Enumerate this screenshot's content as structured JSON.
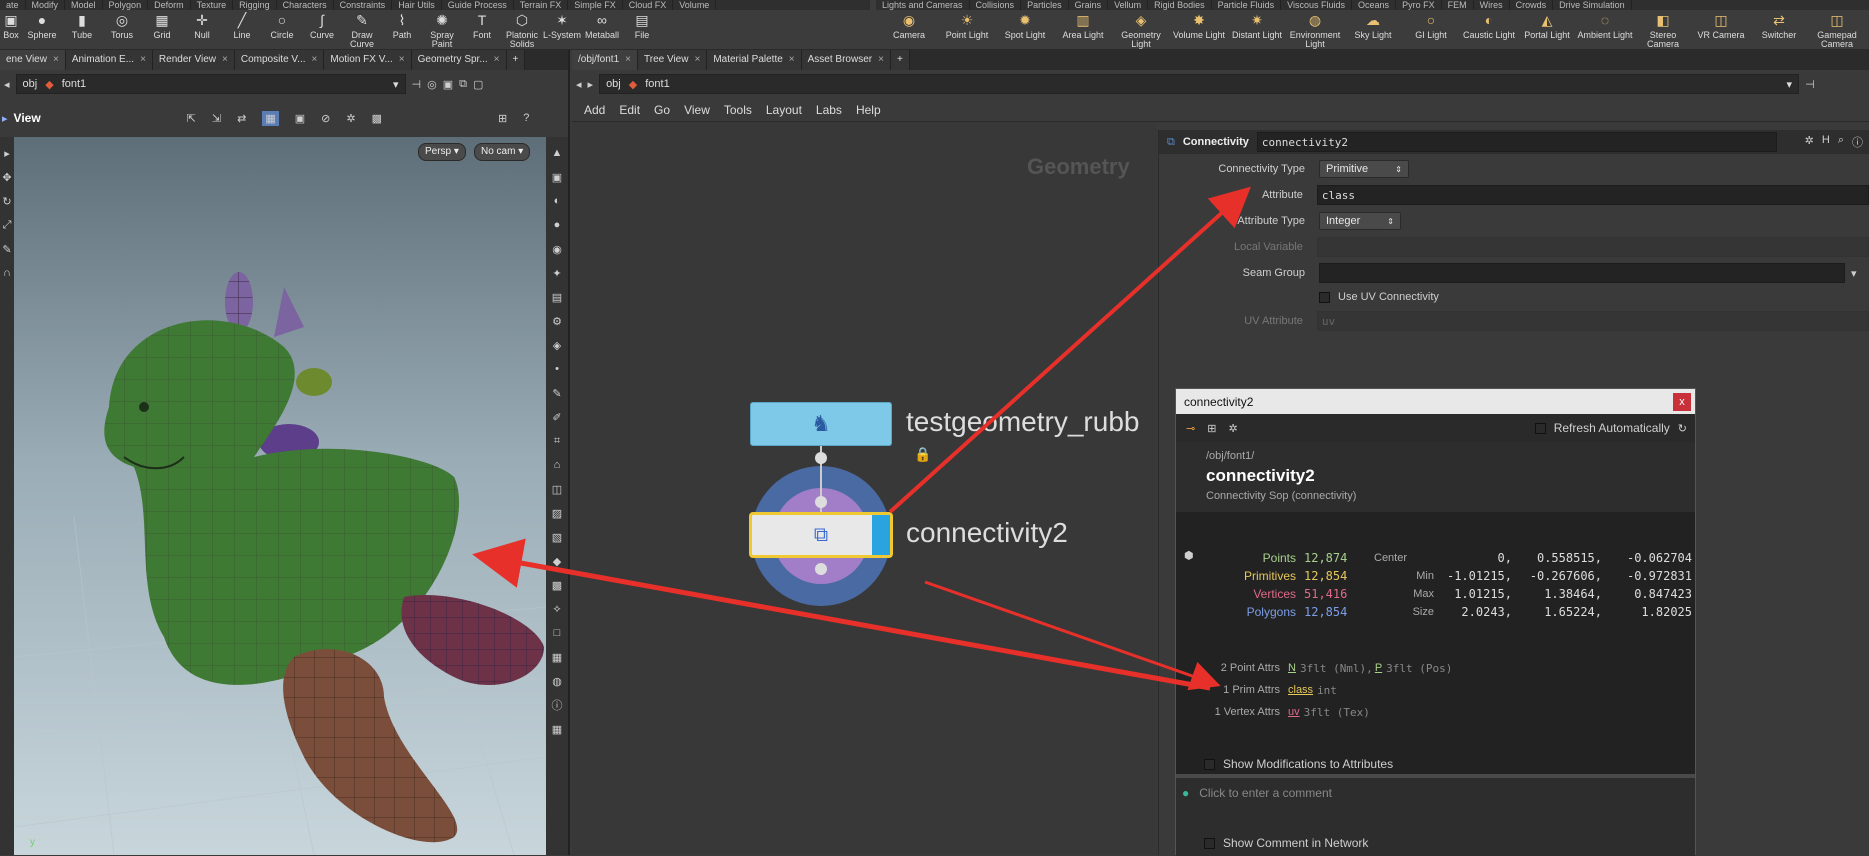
{
  "shelf": {
    "left_tabs": [
      "ate",
      "Modify",
      "Model",
      "Polygon",
      "Deform",
      "Texture",
      "Rigging",
      "Characters",
      "Constraints",
      "Hair Utils",
      "Guide Process",
      "Terrain FX",
      "Simple FX",
      "Cloud FX",
      "Volume"
    ],
    "right_tabs": [
      "Lights and Cameras",
      "Collisions",
      "Particles",
      "Grains",
      "Vellum",
      "Rigid Bodies",
      "Particle Fluids",
      "Viscous Fluids",
      "Oceans",
      "Pyro FX",
      "FEM",
      "Wires",
      "Crowds",
      "Drive Simulation"
    ],
    "left_tools": [
      {
        "label": "Box",
        "icon": "box-icon"
      },
      {
        "label": "Sphere",
        "icon": "sphere-icon"
      },
      {
        "label": "Tube",
        "icon": "tube-icon"
      },
      {
        "label": "Torus",
        "icon": "torus-icon"
      },
      {
        "label": "Grid",
        "icon": "grid-icon"
      },
      {
        "label": "Null",
        "icon": "null-icon"
      },
      {
        "label": "Line",
        "icon": "line-icon"
      },
      {
        "label": "Circle",
        "icon": "circle-icon"
      },
      {
        "label": "Curve",
        "icon": "curve-icon"
      },
      {
        "label": "Draw Curve",
        "icon": "draw-curve-icon"
      },
      {
        "label": "Path",
        "icon": "path-icon"
      },
      {
        "label": "Spray Paint",
        "icon": "spray-paint-icon"
      },
      {
        "label": "Font",
        "icon": "font-icon"
      },
      {
        "label": "Platonic Solids",
        "icon": "platonic-icon"
      },
      {
        "label": "L-System",
        "icon": "lsystem-icon"
      },
      {
        "label": "Metaball",
        "icon": "metaball-icon"
      },
      {
        "label": "File",
        "icon": "file-icon"
      }
    ],
    "right_tools": [
      {
        "label": "Camera"
      },
      {
        "label": "Point Light"
      },
      {
        "label": "Spot Light"
      },
      {
        "label": "Area Light"
      },
      {
        "label": "Geometry Light"
      },
      {
        "label": "Volume Light"
      },
      {
        "label": "Distant Light"
      },
      {
        "label": "Environment Light"
      },
      {
        "label": "Sky Light"
      },
      {
        "label": "GI Light"
      },
      {
        "label": "Caustic Light"
      },
      {
        "label": "Portal Light"
      },
      {
        "label": "Ambient Light"
      },
      {
        "label": "Stereo Camera"
      },
      {
        "label": "VR Camera"
      },
      {
        "label": "Switcher"
      },
      {
        "label": "Gamepad Camera"
      }
    ]
  },
  "left_pane": {
    "tabs": [
      "ene View",
      "Animation E...",
      "Render View",
      "Composite V...",
      "Motion FX V...",
      "Geometry Spr..."
    ],
    "path_root": "obj",
    "path_node": "font1",
    "view_label": "View",
    "persp": "Persp",
    "cam": "No cam",
    "axis_label": "y"
  },
  "network": {
    "tabs": [
      "/obj/font1",
      "Tree View",
      "Material Palette",
      "Asset Browser"
    ],
    "path_root": "obj",
    "path_node": "font1",
    "menu": [
      "Add",
      "Edit",
      "Go",
      "View",
      "Tools",
      "Layout",
      "Labs",
      "Help"
    ],
    "context_label": "Geometry",
    "node1_label": "testgeometry_rubb",
    "node2_label": "connectivity2"
  },
  "params": {
    "node_type": "Connectivity",
    "node_name": "connectivity2",
    "rows": {
      "connectivity_type_label": "Connectivity Type",
      "connectivity_type_value": "Primitive",
      "attribute_label": "Attribute",
      "attribute_value": "class",
      "attribute_type_label": "Attribute Type",
      "attribute_type_value": "Integer",
      "local_variable_label": "Local Variable",
      "seam_group_label": "Seam Group",
      "use_uv_label": "Use UV Connectivity",
      "uv_attribute_label": "UV Attribute",
      "uv_attribute_placeholder": "uv"
    }
  },
  "info": {
    "title": "connectivity2",
    "refresh_label": "Refresh Automatically",
    "path": "/obj/font1/",
    "node": "connectivity2",
    "node_type": "Connectivity Sop (connectivity)",
    "stats": [
      {
        "label": "Points",
        "value": "12,874",
        "color": "#a8d08d"
      },
      {
        "label": "Primitives",
        "value": "12,854",
        "color": "#e6c85a"
      },
      {
        "label": "Vertices",
        "value": "51,416",
        "color": "#e06a8a"
      },
      {
        "label": "Polygons",
        "value": "12,854",
        "color": "#7d9ee6"
      }
    ],
    "bounds": [
      {
        "label": "Center",
        "x": "0,",
        "y": "0.558515,",
        "z": "-0.062704"
      },
      {
        "label": "Min",
        "x": "-1.01215,",
        "y": "-0.267606,",
        "z": "-0.972831"
      },
      {
        "label": "Max",
        "x": "1.01215,",
        "y": "1.38464,",
        "z": "0.847423"
      },
      {
        "label": "Size",
        "x": "2.0243,",
        "y": "1.65224,",
        "z": "1.82025"
      }
    ],
    "attr_point_label": "2 Point Attrs",
    "attr_point_n": "N",
    "attr_point_n_type": "3flt (Nml),",
    "attr_point_p": "P",
    "attr_point_p_type": "3flt (Pos)",
    "attr_prim_label": "1 Prim Attrs",
    "attr_prim_name": "class",
    "attr_prim_type": "int",
    "attr_vtx_label": "1 Vertex Attrs",
    "attr_vtx_name": "uv",
    "attr_vtx_type": "3flt (Tex)",
    "show_mods": "Show Modifications to Attributes",
    "comment_placeholder": "Click to enter a comment",
    "show_comment": "Show Comment in Network"
  }
}
